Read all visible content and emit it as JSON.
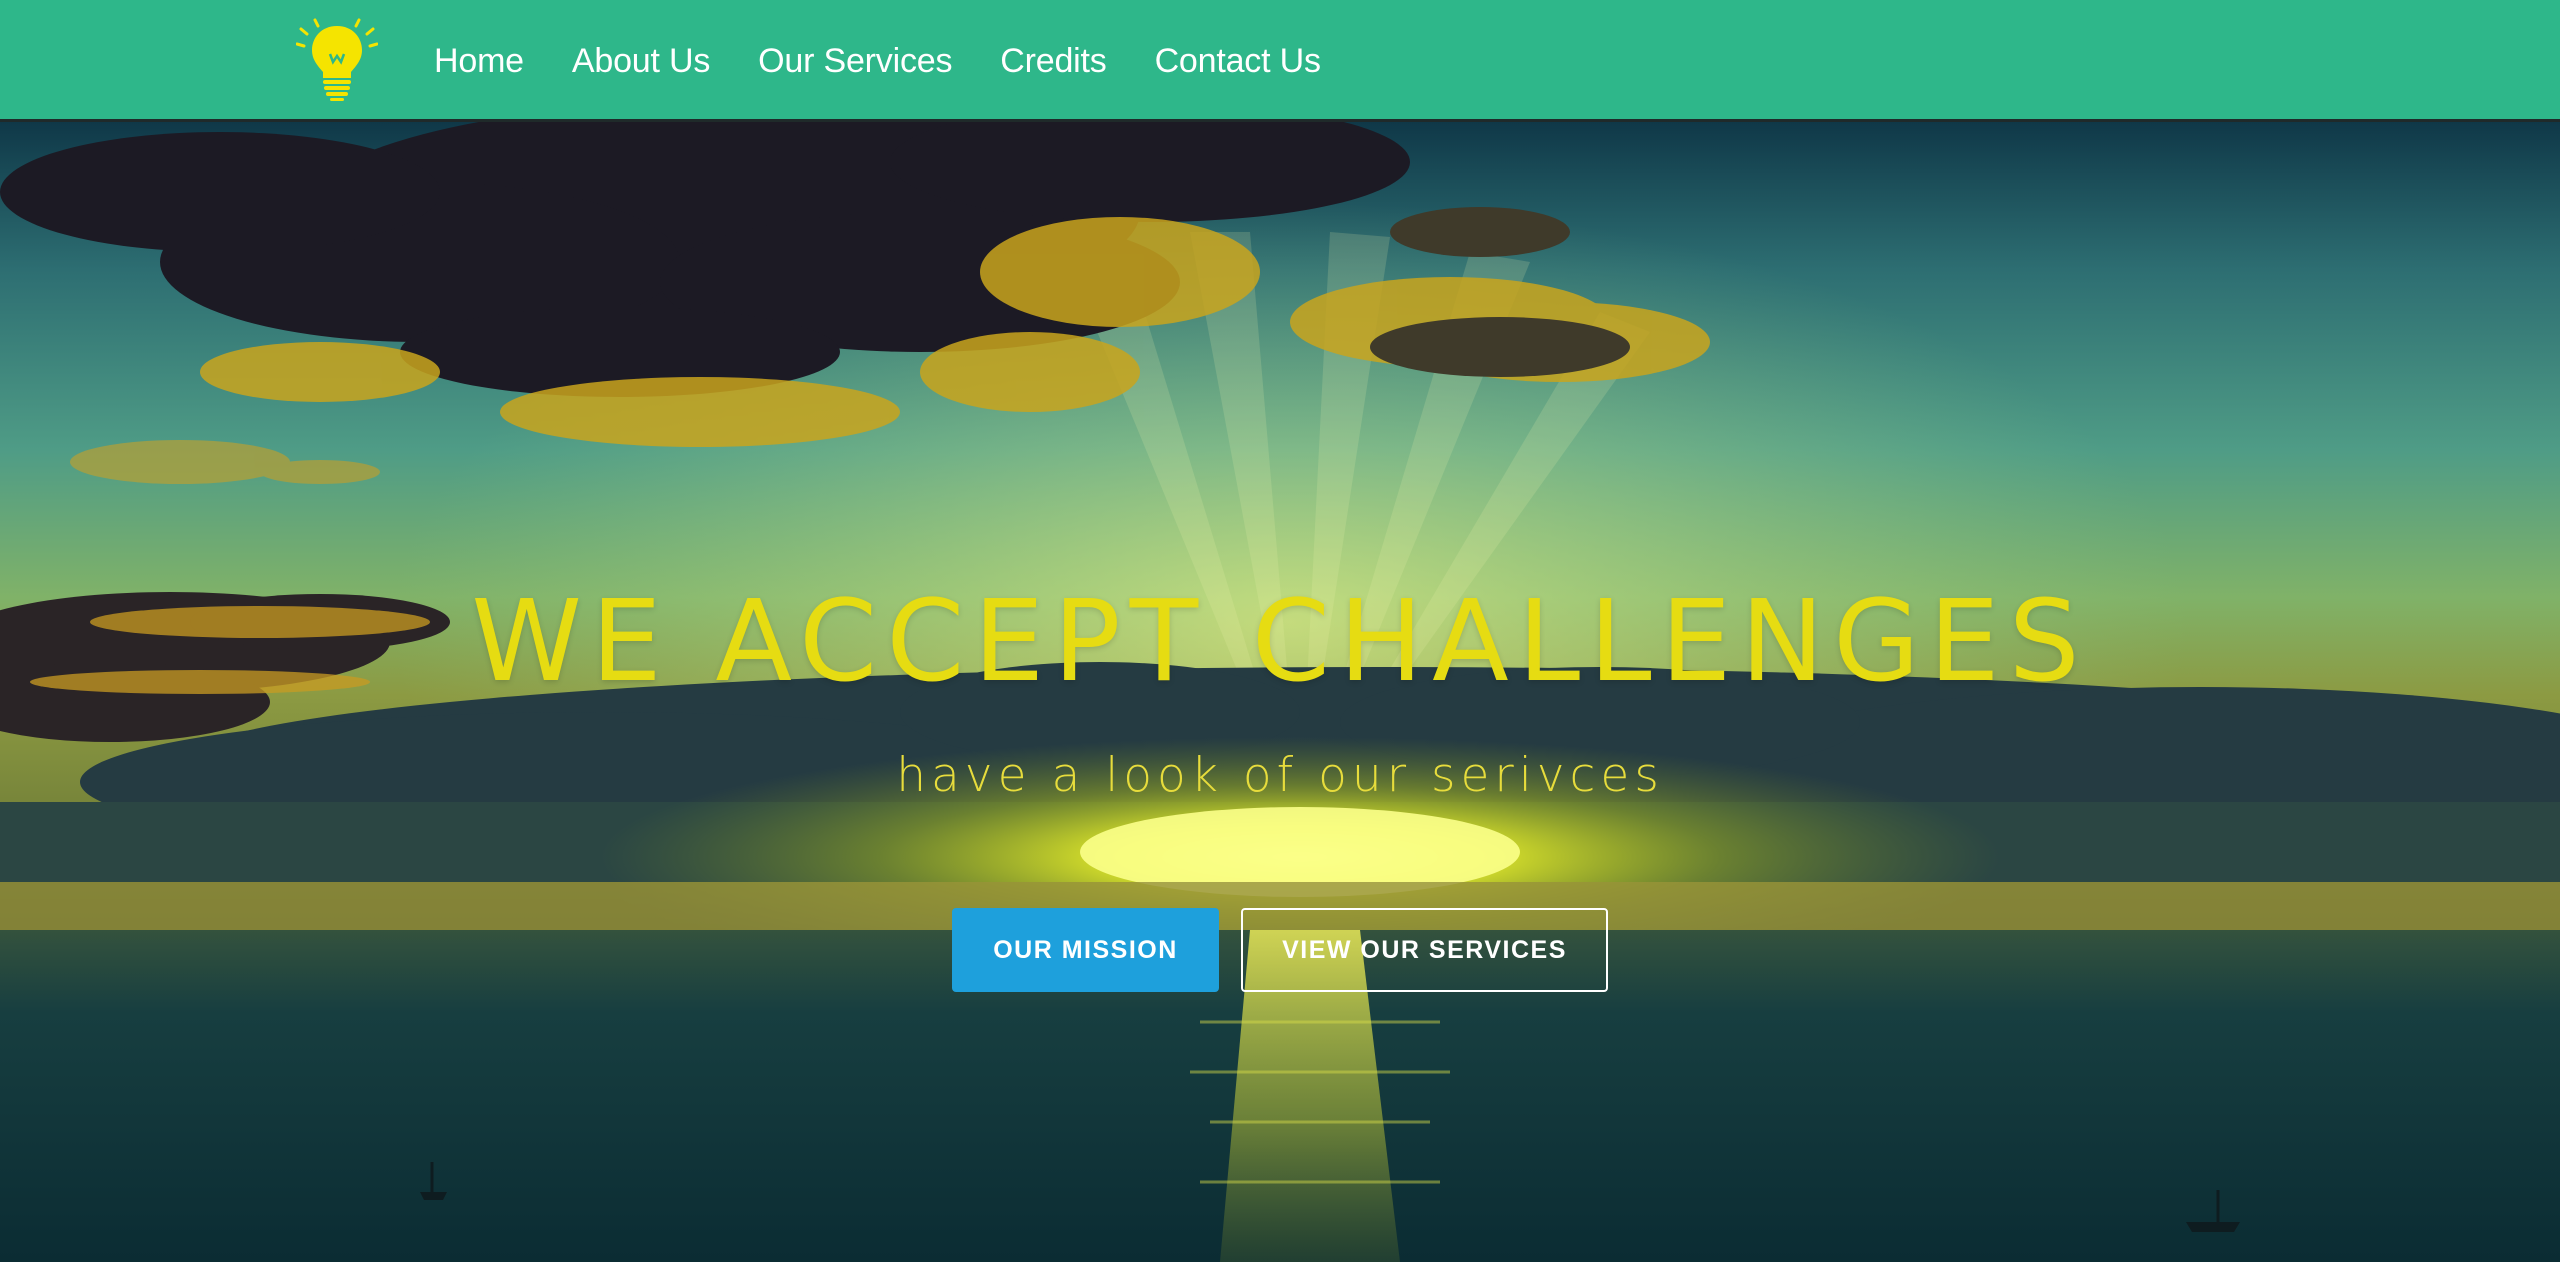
{
  "colors": {
    "navbar_bg": "#2eb78a",
    "headline": "#e6dc12",
    "subline": "#e7dc3c",
    "primary_button": "#1ea0dc",
    "outline_button_border": "#ffffff",
    "logo": "#f5e400"
  },
  "logo": {
    "icon": "lightbulb-icon"
  },
  "nav": {
    "items": [
      {
        "label": "Home"
      },
      {
        "label": "About Us"
      },
      {
        "label": "Our Services"
      },
      {
        "label": "Credits"
      },
      {
        "label": "Contact Us"
      }
    ]
  },
  "hero": {
    "background": "sunset-over-sea-image",
    "headline": "WE ACCEPT CHALLENGES",
    "subline": "have a look of our serivces",
    "buttons": {
      "mission": "OUR MISSION",
      "services": "VIEW OUR SERVICES"
    }
  }
}
